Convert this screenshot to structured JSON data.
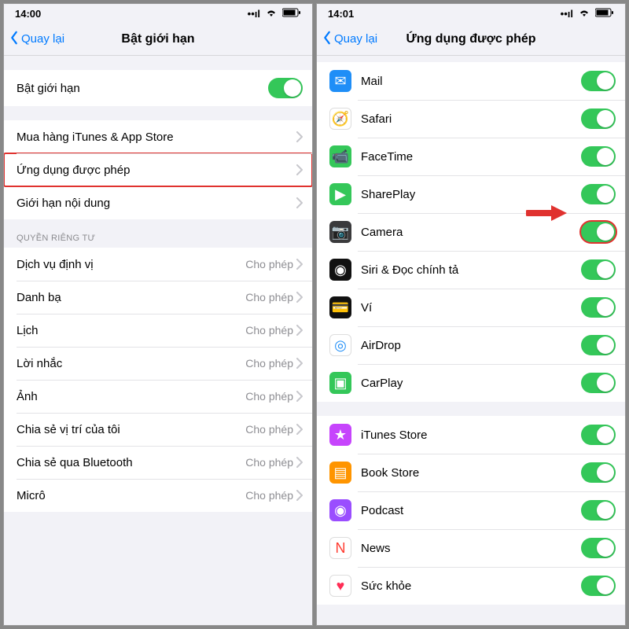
{
  "left": {
    "status": {
      "time": "14:00"
    },
    "back": "Quay lại",
    "title": "Bật giới hạn",
    "enable_row": "Bật giới hạn",
    "section2": [
      {
        "label": "Mua hàng iTunes & App Store"
      },
      {
        "label": "Ứng dụng được phép",
        "highlight": true
      },
      {
        "label": "Giới hạn nội dung"
      }
    ],
    "privacy_header": "QUYỀN RIÊNG TƯ",
    "privacy_detail": "Cho phép",
    "privacy_rows": [
      {
        "label": "Dịch vụ định vị"
      },
      {
        "label": "Danh bạ"
      },
      {
        "label": "Lịch"
      },
      {
        "label": "Lời nhắc"
      },
      {
        "label": "Ảnh"
      },
      {
        "label": "Chia sẻ vị trí của tôi"
      },
      {
        "label": "Chia sẻ qua Bluetooth"
      },
      {
        "label": "Micrô"
      }
    ]
  },
  "right": {
    "status": {
      "time": "14:01"
    },
    "back": "Quay lại",
    "title": "Ứng dụng được phép",
    "apps1": [
      {
        "label": "Mail",
        "icon": "mail-icon",
        "bg": "#1f8ef7",
        "glyph": "✉"
      },
      {
        "label": "Safari",
        "icon": "safari-icon",
        "bg": "#ffffff",
        "glyph": "🧭"
      },
      {
        "label": "FaceTime",
        "icon": "facetime-icon",
        "bg": "#34c759",
        "glyph": "📹"
      },
      {
        "label": "SharePlay",
        "icon": "shareplay-icon",
        "bg": "#34c759",
        "glyph": "▶"
      },
      {
        "label": "Camera",
        "icon": "camera-icon",
        "bg": "#3a3a3c",
        "glyph": "📷",
        "highlight": true
      },
      {
        "label": "Siri & Đọc chính tả",
        "icon": "siri-icon",
        "bg": "#111",
        "glyph": "◉"
      },
      {
        "label": "Ví",
        "icon": "wallet-icon",
        "bg": "#111",
        "glyph": "💳"
      },
      {
        "label": "AirDrop",
        "icon": "airdrop-icon",
        "bg": "#ffffff",
        "glyph": "◎"
      },
      {
        "label": "CarPlay",
        "icon": "carplay-icon",
        "bg": "#34c759",
        "glyph": "▣"
      }
    ],
    "apps2": [
      {
        "label": "iTunes Store",
        "icon": "itunes-icon",
        "bg": "#c644fc",
        "glyph": "★"
      },
      {
        "label": "Book Store",
        "icon": "books-icon",
        "bg": "#ff9500",
        "glyph": "▤"
      },
      {
        "label": "Podcast",
        "icon": "podcast-icon",
        "bg": "#9a4dff",
        "glyph": "◉"
      },
      {
        "label": "News",
        "icon": "news-icon",
        "bg": "#ffffff",
        "glyph": "N"
      },
      {
        "label": "Sức khỏe",
        "icon": "health-icon",
        "bg": "#ffffff",
        "glyph": "♥"
      }
    ]
  }
}
